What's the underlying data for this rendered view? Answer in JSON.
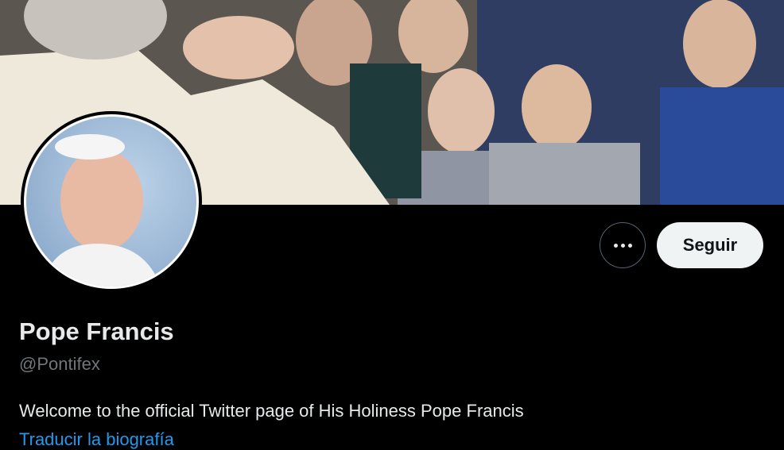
{
  "profile": {
    "name": "Pope Francis",
    "handle": "@Pontifex",
    "bio": "Welcome to the official Twitter page of His Holiness Pope Francis",
    "translate_bio_label": "Traducir la biografía"
  },
  "actions": {
    "follow_label": "Seguir",
    "more_icon": "more-horizontal-icon"
  },
  "colors": {
    "background": "#000000",
    "name_text": "#e7e9ea",
    "secondary_text": "#71767b",
    "link": "#1d9bf0",
    "follow_button_bg": "#eff3f4",
    "follow_button_text": "#0f1419"
  }
}
